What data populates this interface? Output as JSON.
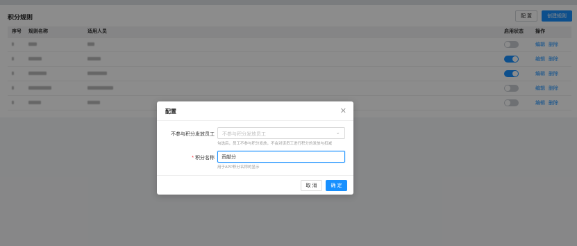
{
  "page": {
    "title": "积分规则",
    "config_button": "配 置",
    "create_button": "创建规则"
  },
  "table": {
    "columns": [
      "序号",
      "规则名称",
      "适用人员",
      "启用状态",
      "操作"
    ],
    "rows": [
      {
        "enabled": false,
        "edit": "编辑",
        "delete": "删除"
      },
      {
        "enabled": true,
        "edit": "编辑",
        "delete": "删除"
      },
      {
        "enabled": true,
        "edit": "编辑",
        "delete": "删除"
      },
      {
        "enabled": false,
        "edit": "编辑",
        "delete": "删除"
      },
      {
        "enabled": false,
        "edit": "编辑",
        "delete": "删除"
      }
    ]
  },
  "modal": {
    "title": "配置",
    "close_icon": "close-icon",
    "exclude_label": "不参与积分发放员工",
    "exclude_placeholder": "不参与积分发放员工",
    "exclude_hint": "勾选后，员工不参与积分发放，不会对该员工进行积分的发放与扣减",
    "points_name_label": "积分名称",
    "points_name_value": "贡献分",
    "points_name_hint": "用于APP积分名称的显示",
    "cancel_button": "取 消",
    "ok_button": "确 定"
  },
  "colors": {
    "primary": "#1890ff",
    "required": "#f5222d"
  }
}
